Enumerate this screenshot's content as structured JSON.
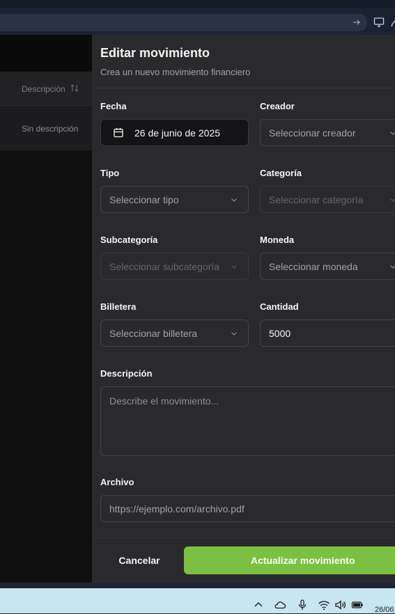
{
  "background": {
    "column_header": "Descripción",
    "row_text": "Sin descripción"
  },
  "dialog": {
    "title": "Editar movimiento",
    "subtitle": "Crea un nuevo movimiento financiero",
    "fecha": {
      "label": "Fecha",
      "value": "26 de junio de 2025"
    },
    "creador": {
      "label": "Creador",
      "placeholder": "Seleccionar creador"
    },
    "tipo": {
      "label": "Tipo",
      "placeholder": "Seleccionar tipo"
    },
    "categoria": {
      "label": "Categoría",
      "placeholder": "Seleccionar categoría"
    },
    "subcategoria": {
      "label": "Subcategoría",
      "placeholder": "Seleccionar subcategoría"
    },
    "moneda": {
      "label": "Moneda",
      "placeholder": "Seleccionar moneda"
    },
    "billetera": {
      "label": "Billetera",
      "placeholder": "Seleccionar billetera"
    },
    "cantidad": {
      "label": "Cantidad",
      "value": "5000"
    },
    "descripcion": {
      "label": "Descripción",
      "placeholder": "Describe el movimiento..."
    },
    "archivo": {
      "label": "Archivo",
      "placeholder": "https://ejemplo.com/archivo.pdf"
    },
    "cancel_label": "Cancelar",
    "submit_label": "Actualizar movimiento"
  },
  "taskbar": {
    "date": "26/06"
  },
  "colors": {
    "accent": "#7cc043",
    "dialog_bg": "#2a2a2c",
    "app_bg": "#0f0f10"
  }
}
